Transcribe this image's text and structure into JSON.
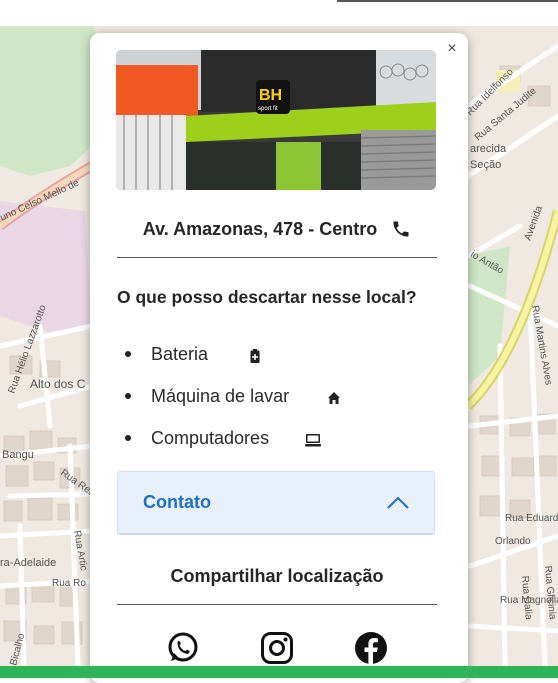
{
  "map": {
    "street_labels": [
      "uno Celso Mello de",
      "Rua Hélio Lazzarotto",
      "Alto dos C",
      "Bangu",
      "Rua Realeng",
      "ra-Adelaide",
      "Rua Ro",
      "Rua Artic",
      "Bicalho",
      "Rua Idelfonso",
      "Rua Santa Judite",
      "arecida",
      "Seção",
      "Avenida",
      "io Antão",
      "Rua Martins Alves",
      "Rua Eduard",
      "Orlando",
      "Rua Dalia",
      "Rua Glicinia",
      "Rua Magnolia"
    ]
  },
  "popup": {
    "close_label": "×",
    "photo": {
      "sign_text": "BH",
      "sign_sub": "sport fit"
    },
    "address": "Av. Amazonas, 478 - Centro",
    "address_icon": "phone-icon",
    "question": "O que posso descartar nesse local?",
    "items": [
      {
        "label": "Bateria",
        "icon": "battery-icon"
      },
      {
        "label": "Máquina de lavar",
        "icon": "house-icon"
      },
      {
        "label": "Computadores",
        "icon": "computer-icon"
      }
    ],
    "contact": {
      "label": "Contato",
      "icon": "chevron-up-icon",
      "expanded": true
    },
    "share": {
      "title": "Compartilhar localização",
      "networks": [
        {
          "name": "WhatsApp",
          "icon": "whatsapp-icon"
        },
        {
          "name": "Instagram",
          "icon": "instagram-icon"
        },
        {
          "name": "Facebook",
          "icon": "facebook-icon"
        }
      ]
    }
  },
  "colors": {
    "accent": "#1f6fc6",
    "contact_bg": "#e8f0fb",
    "bottom_bar": "#2fb45a",
    "text": "#262626"
  }
}
